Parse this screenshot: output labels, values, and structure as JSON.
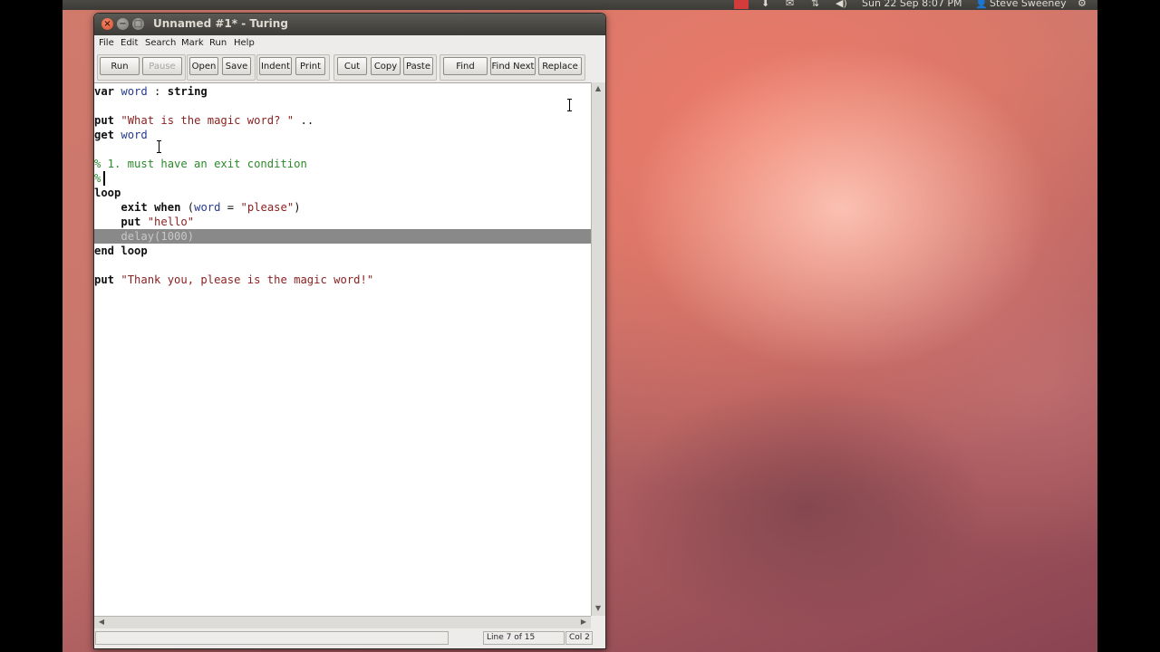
{
  "top_panel": {
    "datetime": "Sun 22 Sep  8:07 PM",
    "user": "Steve Sweeney",
    "icons": [
      "indicator-red-icon",
      "download-arrow-icon",
      "mail-icon",
      "network-icon",
      "volume-icon",
      "user-icon",
      "gear-icon"
    ]
  },
  "window": {
    "title": "Unnamed #1* - Turing",
    "controls": [
      "close",
      "minimize",
      "maximize"
    ]
  },
  "menu": {
    "file": "File",
    "edit": "Edit",
    "search": "Search",
    "mark": "Mark",
    "run": "Run",
    "help": "Help"
  },
  "toolbar": {
    "run": "Run",
    "pause": "Pause",
    "open": "Open",
    "save": "Save",
    "indent": "Indent",
    "print": "Print",
    "cut": "Cut",
    "copy": "Copy",
    "paste": "Paste",
    "find": "Find",
    "find_next": "Find Next",
    "replace": "Replace"
  },
  "code": {
    "l1": {
      "a": "var",
      "b": " ",
      "c": "word",
      "d": " : ",
      "e": "string"
    },
    "l3": {
      "a": "put",
      "b": " ",
      "c": "\"What is the magic word? \"",
      "d": " .."
    },
    "l4": {
      "a": "get",
      "b": " ",
      "c": "word"
    },
    "l6": {
      "a": "% 1. must have an exit condition"
    },
    "l7": {
      "a": "%"
    },
    "l8": {
      "a": "loop"
    },
    "l9": {
      "indent": "    ",
      "a": "exit",
      "b": " ",
      "c": "when",
      "d": " (",
      "e": "word",
      "f": " = ",
      "g": "\"please\"",
      "h": ")"
    },
    "l10": {
      "indent": "    ",
      "a": "put",
      "b": " ",
      "c": "\"hello\""
    },
    "l11": {
      "indent": "    ",
      "a": "delay(1000)"
    },
    "l12": {
      "a": "end",
      "b": " ",
      "c": "loop"
    },
    "l14": {
      "a": "put",
      "b": " ",
      "c": "\"Thank you, please is the magic word!\""
    }
  },
  "status": {
    "message": "",
    "line": "Line 7 of 15",
    "col": "Col 2"
  },
  "colors": {
    "keyword": "#101010",
    "identifier": "#253a8c",
    "string": "#8a1f1f",
    "comment": "#2b8a2b",
    "highlight_line": "#898989"
  }
}
